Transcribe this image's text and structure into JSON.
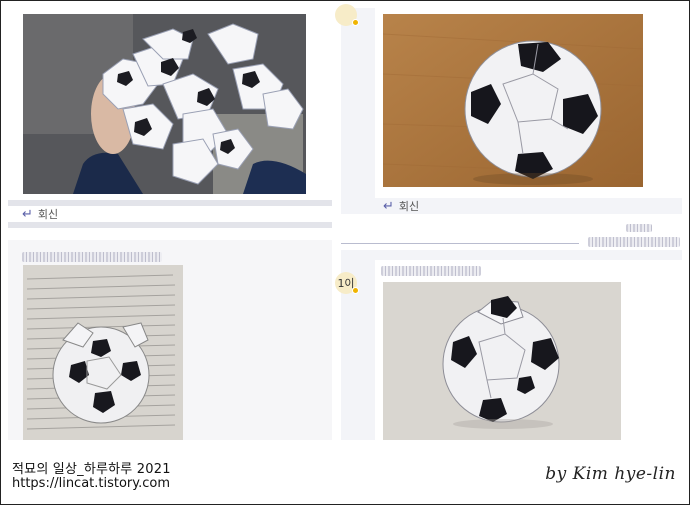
{
  "comments": [
    {
      "id": "top-left",
      "reply_label": "회신"
    },
    {
      "id": "top-right",
      "reply_label": "회신",
      "avatar_text": ""
    },
    {
      "id": "bottom-left"
    },
    {
      "id": "bottom-right",
      "avatar_text": "1이"
    }
  ],
  "footer": {
    "title": "적묘의 일상_하루하루 2021",
    "url": "https://lincat.tistory.com",
    "signature": "by Kim hye-lin"
  },
  "icons": {
    "reply": "reply-arrow-icon",
    "badge": "badge-dot-icon"
  },
  "colors": {
    "reply_arrow": "#5a5fa8",
    "badge": "#f0b400",
    "panel_bg": "#f3f4f8"
  }
}
